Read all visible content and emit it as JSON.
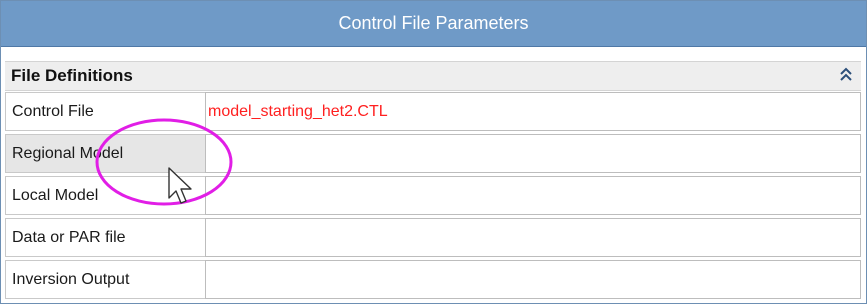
{
  "window": {
    "title": "Control File Parameters"
  },
  "section": {
    "title": "File Definitions",
    "collapse_icon": "double-chevron-up-icon"
  },
  "rows": [
    {
      "label": "Control File",
      "value": "model_starting_het2.CTL"
    },
    {
      "label": "Regional Model",
      "value": ""
    },
    {
      "label": "Local Model",
      "value": ""
    },
    {
      "label": "Data or PAR file",
      "value": ""
    },
    {
      "label": "Inversion Output",
      "value": ""
    }
  ],
  "colors": {
    "title_bar": "#6f9ac7",
    "value_text": "#ff2020",
    "annotation": "#e11ee6"
  }
}
